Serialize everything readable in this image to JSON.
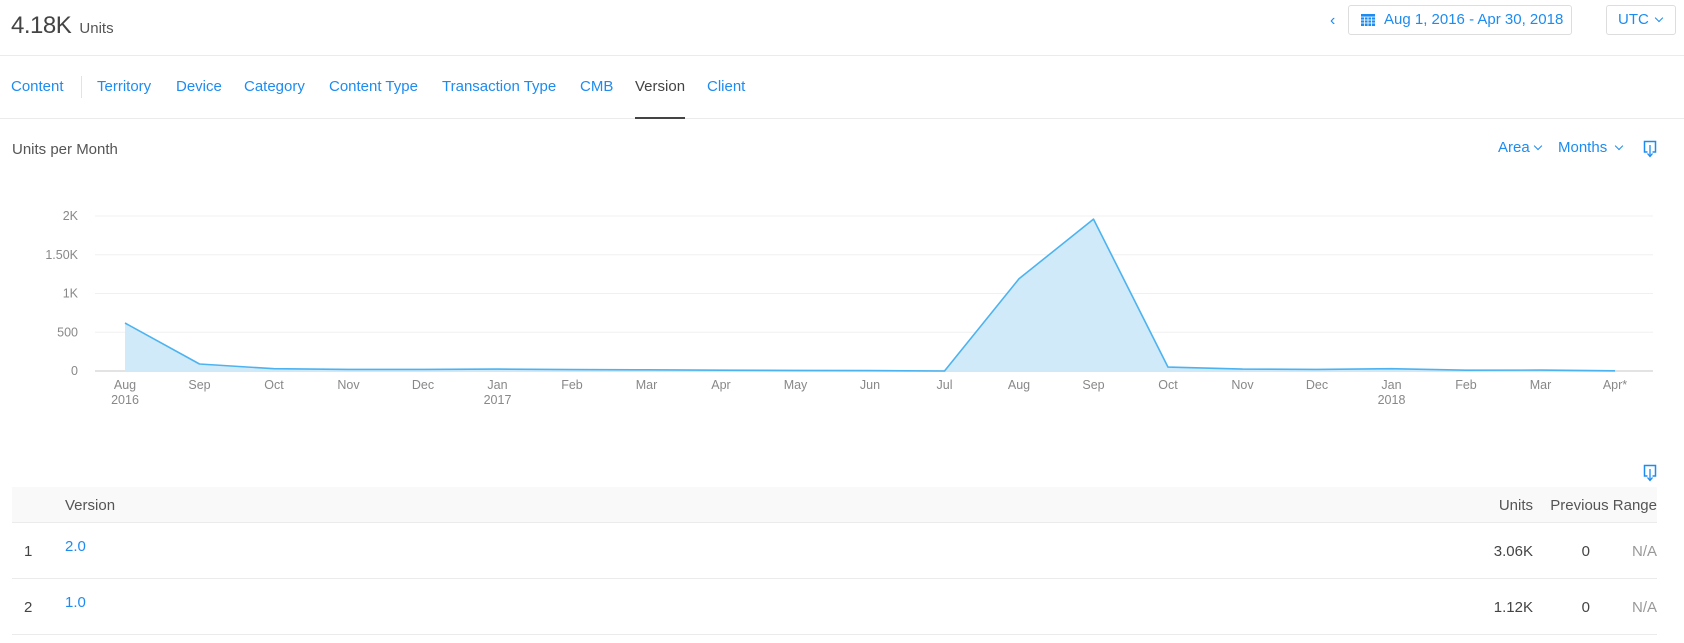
{
  "header": {
    "total_value": "4.18K",
    "total_unit": "Units",
    "prev_icon": "chevron-left-icon",
    "date_range": "Aug 1, 2016 - Apr 30, 2018",
    "calendar_icon": "calendar-icon",
    "timezone": "UTC"
  },
  "tabs": [
    {
      "label": "Content",
      "active": false
    },
    {
      "label": "Territory",
      "active": false
    },
    {
      "label": "Device",
      "active": false
    },
    {
      "label": "Category",
      "active": false
    },
    {
      "label": "Content Type",
      "active": false
    },
    {
      "label": "Transaction Type",
      "active": false
    },
    {
      "label": "CMB",
      "active": false
    },
    {
      "label": "Version",
      "active": true
    },
    {
      "label": "Client",
      "active": false
    }
  ],
  "chart_controls": {
    "title": "Units per Month",
    "chart_type": "Area",
    "interval": "Months",
    "download_icon": "download-icon"
  },
  "colors": {
    "accent": "#1d8cf0",
    "series_line": "#4db3f0",
    "series_fill": "#cfe9fa"
  },
  "chart_data": {
    "type": "area",
    "title": "Units per Month",
    "xlabel": "",
    "ylabel": "",
    "ylim": [
      0,
      2000
    ],
    "grid": true,
    "legend": "none",
    "y_ticks": [
      {
        "value": 0,
        "label": "0"
      },
      {
        "value": 500,
        "label": "500"
      },
      {
        "value": 1000,
        "label": "1K"
      },
      {
        "value": 1500,
        "label": "1.50K"
      },
      {
        "value": 2000,
        "label": "2K"
      }
    ],
    "categories": [
      {
        "label": "Aug",
        "sub": "2016"
      },
      {
        "label": "Sep",
        "sub": ""
      },
      {
        "label": "Oct",
        "sub": ""
      },
      {
        "label": "Nov",
        "sub": ""
      },
      {
        "label": "Dec",
        "sub": ""
      },
      {
        "label": "Jan",
        "sub": "2017"
      },
      {
        "label": "Feb",
        "sub": ""
      },
      {
        "label": "Mar",
        "sub": ""
      },
      {
        "label": "Apr",
        "sub": ""
      },
      {
        "label": "May",
        "sub": ""
      },
      {
        "label": "Jun",
        "sub": ""
      },
      {
        "label": "Jul",
        "sub": ""
      },
      {
        "label": "Aug",
        "sub": ""
      },
      {
        "label": "Sep",
        "sub": ""
      },
      {
        "label": "Oct",
        "sub": ""
      },
      {
        "label": "Nov",
        "sub": ""
      },
      {
        "label": "Dec",
        "sub": ""
      },
      {
        "label": "Jan",
        "sub": "2018"
      },
      {
        "label": "Feb",
        "sub": ""
      },
      {
        "label": "Mar",
        "sub": ""
      },
      {
        "label": "Apr*",
        "sub": ""
      }
    ],
    "series": [
      {
        "name": "Units",
        "values": [
          620,
          90,
          30,
          20,
          20,
          25,
          18,
          15,
          10,
          8,
          5,
          0,
          1190,
          1960,
          50,
          25,
          20,
          30,
          10,
          12,
          2
        ]
      }
    ]
  },
  "table": {
    "download_icon": "download-icon",
    "columns": [
      "",
      "Version",
      "Units",
      "Previous Range",
      ""
    ],
    "rows": [
      {
        "rank": "1",
        "version": "2.0",
        "units": "3.06K",
        "previous": "0",
        "change": "N/A"
      },
      {
        "rank": "2",
        "version": "1.0",
        "units": "1.12K",
        "previous": "0",
        "change": "N/A"
      }
    ]
  }
}
